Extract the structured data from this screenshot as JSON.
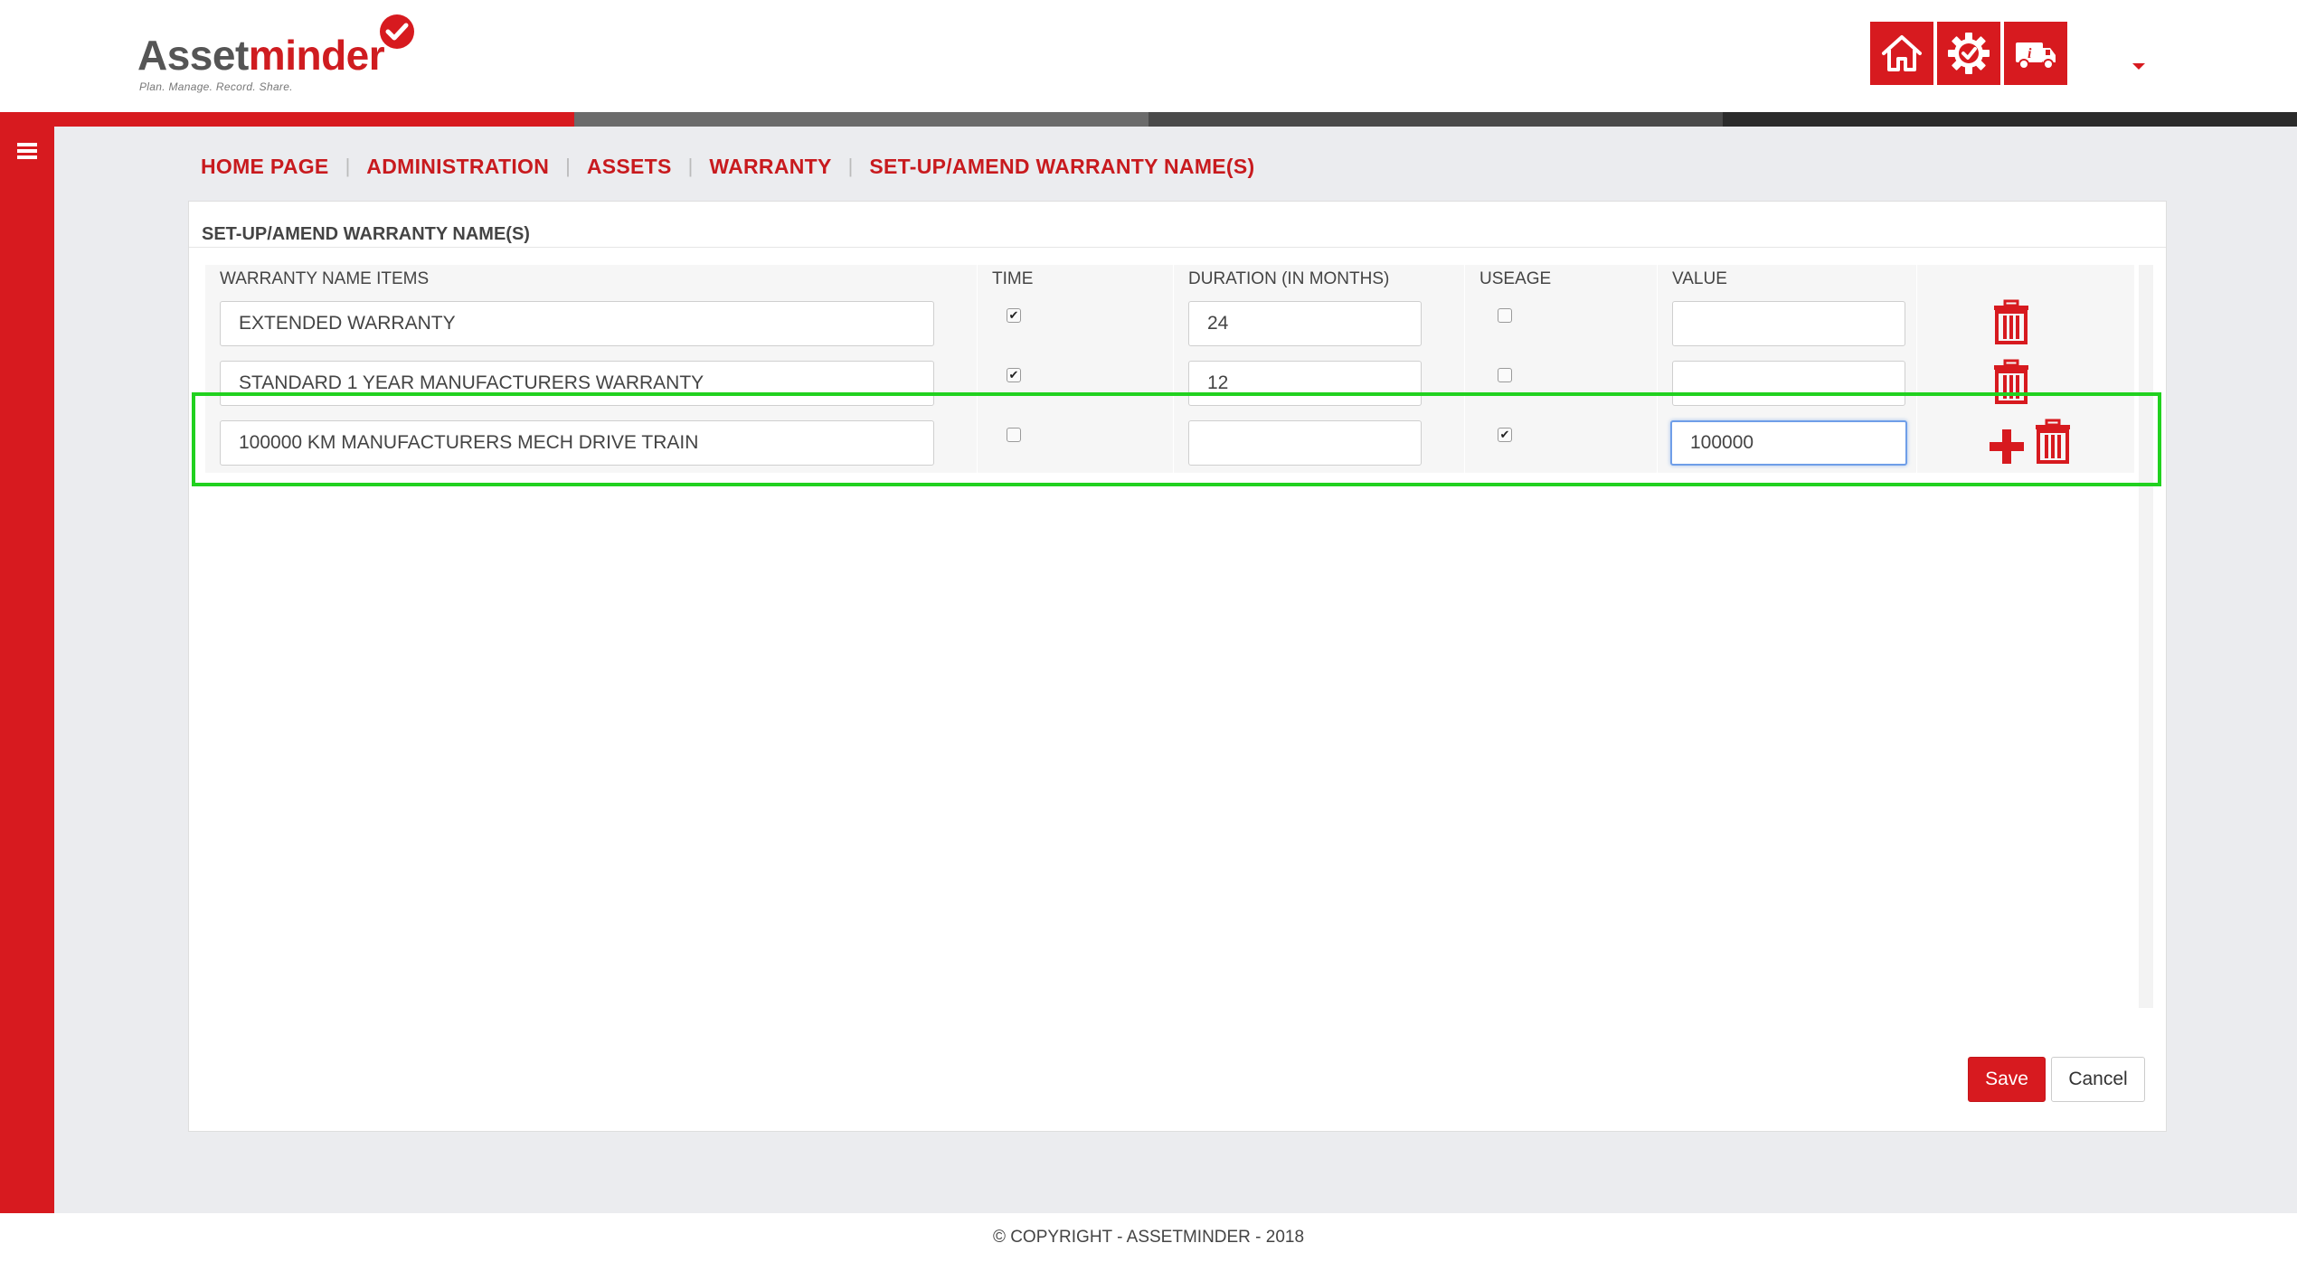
{
  "logo": {
    "name_part1": "Asset",
    "name_part2": "minder",
    "tagline": "Plan. Manage. Record. Share."
  },
  "header": {
    "buttons": [
      {
        "icon": "home-icon"
      },
      {
        "icon": "gear-check-icon"
      },
      {
        "icon": "truck-info-icon"
      }
    ]
  },
  "colors": {
    "brand_red": "#d71a1f",
    "bar": [
      "#d71a1f",
      "#6b6b6b",
      "#4a4a4a",
      "#2b2b2b"
    ],
    "highlight": "#21d11f"
  },
  "breadcrumb": [
    "HOME PAGE",
    "ADMINISTRATION",
    "ASSETS",
    "WARRANTY",
    "SET-UP/AMEND WARRANTY NAME(S)"
  ],
  "breadcrumb_separator": "|",
  "panel": {
    "title": "SET-UP/AMEND WARRANTY NAME(S)"
  },
  "table": {
    "columns": [
      "WARRANTY NAME ITEMS",
      "TIME",
      "DURATION (IN MONTHS)",
      "USEAGE",
      "VALUE"
    ],
    "rows": [
      {
        "name": "EXTENDED WARRANTY",
        "time": true,
        "duration": "24",
        "usage": false,
        "value": ""
      },
      {
        "name": "STANDARD 1 YEAR MANUFACTURERS WARRANTY",
        "time": true,
        "duration": "12",
        "usage": false,
        "value": ""
      },
      {
        "name": "100000 KM MANUFACTURERS MECH DRIVE TRAIN",
        "time": false,
        "duration": "",
        "usage": true,
        "value": "100000"
      }
    ]
  },
  "actions": {
    "save_label": "Save",
    "cancel_label": "Cancel"
  },
  "footer": {
    "text": "© COPYRIGHT - ASSETMINDER - 2018"
  }
}
